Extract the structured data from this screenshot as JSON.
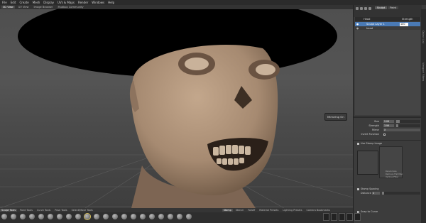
{
  "menu": [
    "File",
    "Edit",
    "Create",
    "Mesh",
    "Display",
    "UVs & Maps",
    "Render",
    "Windows",
    "Help"
  ],
  "view_tabs": [
    "3D View",
    "UV View",
    "Image Browser",
    "Mudbox Community"
  ],
  "viewport": {
    "mirroring_label": "Mirroring On"
  },
  "panel": {
    "tabs": [
      "Sculpt",
      "Paint"
    ],
    "layer_header": {
      "name": "Head",
      "strength": "Strength"
    },
    "layers": [
      {
        "name": "Sculpt Layer 1",
        "strength_value": "100",
        "selected": true
      },
      {
        "name": "head",
        "selected": false
      }
    ],
    "properties": {
      "size": {
        "label": "Size",
        "value": "2.06",
        "fill": 0.15
      },
      "strength": {
        "label": "Strength",
        "value": "3.99",
        "fill": 0.1
      },
      "mirror": {
        "label": "Mirror",
        "value": "X"
      },
      "invert": {
        "label": "Invert Function"
      },
      "use_stamp": {
        "label": "Use Stamp Image"
      },
      "stamp_spacing": {
        "label": "Stamp Spacing"
      },
      "distance": {
        "label": "Distance",
        "value": "4",
        "fill": 0.05
      },
      "snap": {
        "label": "Snap to Curve"
      },
      "stamp_options": [
        "Randomize",
        "Remove Flat Map",
        "Vertical Filter"
      ]
    },
    "side_tabs": [
      "Object List",
      "Viewport Filters"
    ]
  },
  "bottom_tabs": [
    "Sculpt Tools",
    "Paint Tools",
    "Curve Tools",
    "Pose Tools",
    "Select/Move Tools",
    "Stamp",
    "Stencil",
    "Falloff",
    "Material Presets",
    "Lighting Presets",
    "Camera Bookmarks"
  ],
  "colors": {
    "accent": "#4a7ab5",
    "skin": "#a78b72",
    "hat": "#000000"
  }
}
